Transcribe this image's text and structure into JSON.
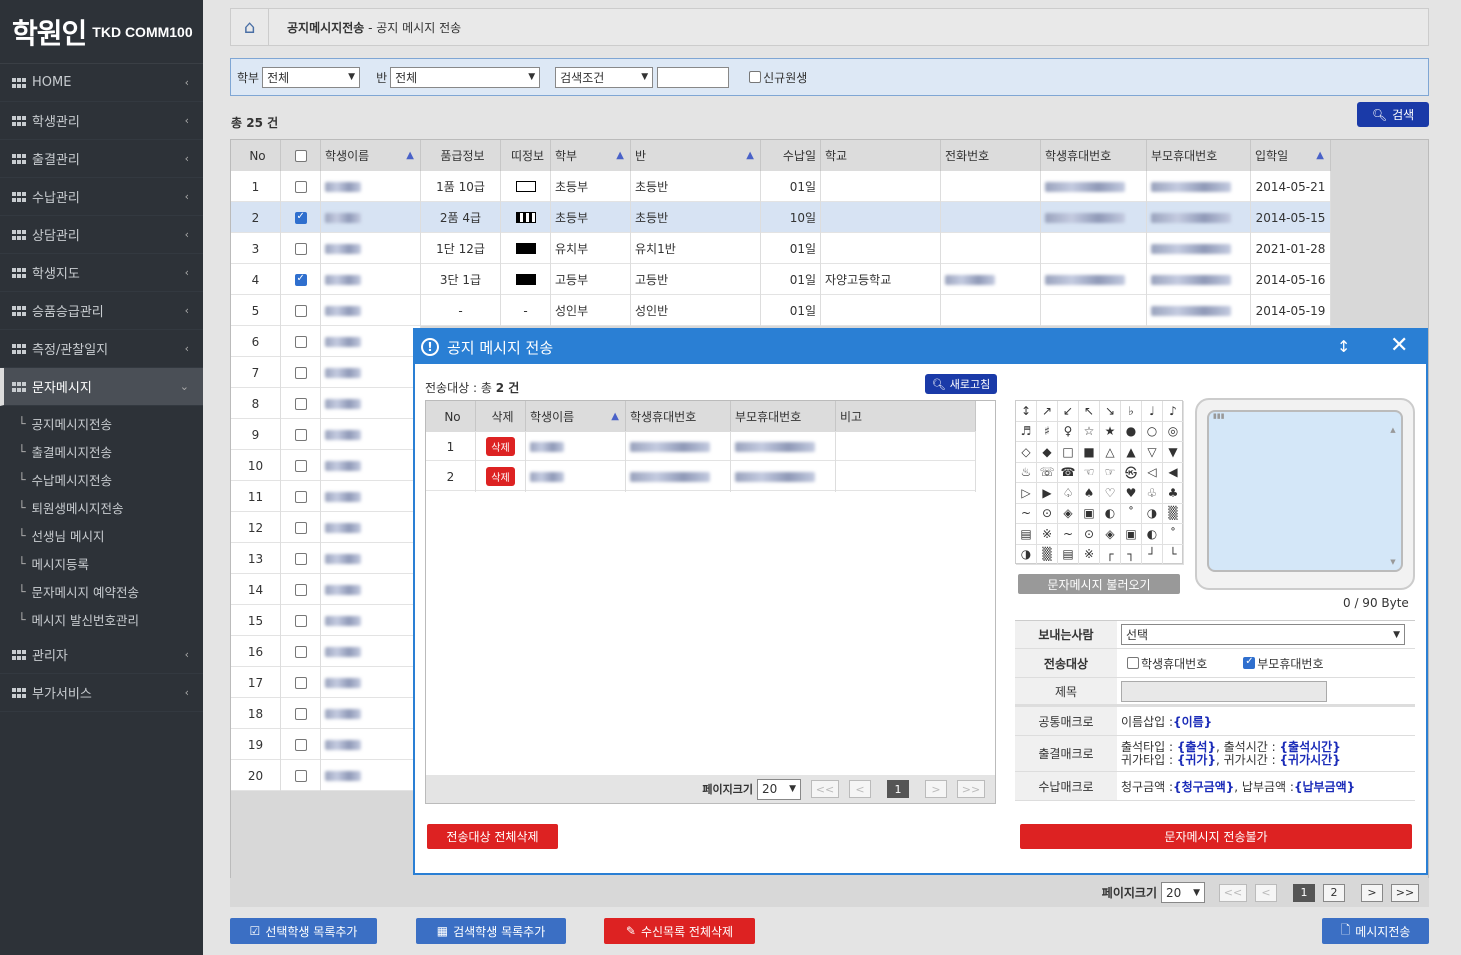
{
  "logo": {
    "main": "학원인",
    "sub": "TKD COMM100"
  },
  "sidebar": {
    "items": [
      {
        "label": "HOME"
      },
      {
        "label": "학생관리"
      },
      {
        "label": "출결관리"
      },
      {
        "label": "수납관리"
      },
      {
        "label": "상담관리"
      },
      {
        "label": "학생지도"
      },
      {
        "label": "승품승급관리"
      },
      {
        "label": "측정/관찰일지"
      },
      {
        "label": "문자메시지"
      }
    ],
    "sub_items": [
      {
        "label": "공지메시지전송"
      },
      {
        "label": "출결메시지전송"
      },
      {
        "label": "수납메시지전송"
      },
      {
        "label": "퇴원생메시지전송"
      },
      {
        "label": "선생님 메시지"
      },
      {
        "label": "메시지등록"
      },
      {
        "label": "문자메시지 예약전송"
      },
      {
        "label": "메시지 발신번호관리"
      }
    ],
    "bottom_items": [
      {
        "label": "관리자"
      },
      {
        "label": "부가서비스"
      }
    ]
  },
  "breadcrumb": {
    "section": "공지메시지전송",
    "sep": " - ",
    "page": "공지 메시지 전송"
  },
  "filter": {
    "dept_label": "학부",
    "dept_value": "전체",
    "class_label": "반",
    "class_value": "전체",
    "cond_value": "검색조건",
    "new_label": "신규원생"
  },
  "total_text": "총 25 건",
  "search_label": "검색",
  "grid": {
    "headers": {
      "no": "No",
      "name": "학생이름",
      "rank": "품급정보",
      "belt": "띠정보",
      "dept": "학부",
      "class": "반",
      "pay": "수납일",
      "school": "학교",
      "tel": "전화번호",
      "sph": "학생휴대번호",
      "pph": "부모휴대번호",
      "date": "입학일"
    },
    "rows": [
      {
        "no": "1",
        "checked": false,
        "rank": "1품 10급",
        "belt": "white",
        "dept": "초등부",
        "class": "초등반",
        "pay": "01일",
        "school": "",
        "tel": false,
        "sph": true,
        "pph": true,
        "date": "2014-05-21",
        "selected": false
      },
      {
        "no": "2",
        "checked": true,
        "rank": "2품 4급",
        "belt": "stripe",
        "dept": "초등부",
        "class": "초등반",
        "pay": "10일",
        "school": "",
        "tel": false,
        "sph": true,
        "pph": true,
        "date": "2014-05-15",
        "selected": true
      },
      {
        "no": "3",
        "checked": false,
        "rank": "1단 12급",
        "belt": "black",
        "dept": "유치부",
        "class": "유치1반",
        "pay": "01일",
        "school": "",
        "tel": false,
        "sph": false,
        "pph": true,
        "date": "2021-01-28",
        "selected": false
      },
      {
        "no": "4",
        "checked": true,
        "rank": "3단 1급",
        "belt": "black",
        "dept": "고등부",
        "class": "고등반",
        "pay": "01일",
        "school": "자양고등학교",
        "tel": true,
        "sph": true,
        "pph": true,
        "date": "2014-05-16",
        "selected": false
      },
      {
        "no": "5",
        "checked": false,
        "rank": "-",
        "belt": "dash",
        "dept": "성인부",
        "class": "성인반",
        "pay": "01일",
        "school": "",
        "tel": false,
        "sph": false,
        "pph": true,
        "date": "2014-05-19",
        "selected": false
      },
      {
        "no": "6"
      },
      {
        "no": "7"
      },
      {
        "no": "8"
      },
      {
        "no": "9"
      },
      {
        "no": "10"
      },
      {
        "no": "11"
      },
      {
        "no": "12"
      },
      {
        "no": "13"
      },
      {
        "no": "14"
      },
      {
        "no": "15"
      },
      {
        "no": "16"
      },
      {
        "no": "17"
      },
      {
        "no": "18"
      },
      {
        "no": "19"
      },
      {
        "no": "20"
      }
    ]
  },
  "pager": {
    "label": "페이지크기",
    "size": "20",
    "first": "<<",
    "prev": "<",
    "pages": [
      "1",
      "2"
    ],
    "next": ">",
    "last": ">>"
  },
  "bottom": {
    "add_selected": "선택학생 목록추가",
    "add_search": "검색학생 목록추가",
    "clear_recv": "수신목록 전체삭제",
    "send_msg": "메시지전송"
  },
  "modal": {
    "title": "공지 메시지 전송",
    "target_prefix": "전송대상 : 총 ",
    "target_count": "2",
    "target_suffix": " 건",
    "refresh": "새로고침",
    "headers": {
      "no": "No",
      "del": "삭제",
      "name": "학생이름",
      "sph": "학생휴대번호",
      "pph": "부모휴대번호",
      "note": "비고"
    },
    "rows": [
      {
        "no": "1",
        "del": "삭제"
      },
      {
        "no": "2",
        "del": "삭제"
      }
    ],
    "pager": {
      "label": "페이지크기",
      "size": "20",
      "first": "<<",
      "prev": "<",
      "page": "1",
      "next": ">",
      "last": ">>"
    },
    "delete_all": "전송대상 전체삭제",
    "send_disabled": "문자메시지 전송불가",
    "symbols": [
      "↕",
      "↗",
      "↙",
      "↖",
      "↘",
      "♭",
      "♩",
      "♪",
      "♬",
      "♯",
      "♀",
      "☆",
      "★",
      "●",
      "○",
      "◎",
      "◇",
      "◆",
      "□",
      "■",
      "△",
      "▲",
      "▽",
      "▼",
      "♨",
      "☏",
      "☎",
      "☜",
      "☞",
      "㉿",
      "◁",
      "◀",
      "▷",
      "▶",
      "♤",
      "♠",
      "♡",
      "♥",
      "♧",
      "♣",
      "~",
      "⊙",
      "◈",
      "▣",
      "◐",
      "˚",
      "◑",
      "▒",
      "▤",
      "※",
      "~",
      "⊙",
      "◈",
      "▣",
      "◐",
      "˚",
      "◑",
      "▒",
      "▤",
      "※",
      "┌",
      "┐",
      "┘",
      "└"
    ],
    "load_msg": "문자메시지 불러오기",
    "bytes": "0 / 90 Byte",
    "form": {
      "sender_label": "보내는사람",
      "sender_value": "선택",
      "target_label": "전송대상",
      "opt_student": "학생휴대번호",
      "opt_parent": "부모휴대번호",
      "subject_label": "제목",
      "common_label": "공통매크로",
      "common_text": "이름삽입 : ",
      "common_macro": "{이름}",
      "att_label": "출결매크로",
      "att_l1a": "출석타입 : ",
      "att_m1a": "{출석}",
      "att_l1b": ",   출석시간 : ",
      "att_m1b": "{출석시간}",
      "att_l2a": "귀가타입 : ",
      "att_m2a": "{귀가}",
      "att_l2b": ",   귀가시간 : ",
      "att_m2b": "{귀가시간}",
      "pay_label": "수납매크로",
      "pay_la": "청구금액 : ",
      "pay_ma": "{청구금액}",
      "pay_lb": ",   납부금액 : ",
      "pay_mb": "{납부금액}"
    }
  },
  "colors": {
    "sidebar": "#2d3238",
    "accent": "#2a7fd4",
    "primary_btn": "#1a3aa8",
    "danger": "#dd2222"
  }
}
